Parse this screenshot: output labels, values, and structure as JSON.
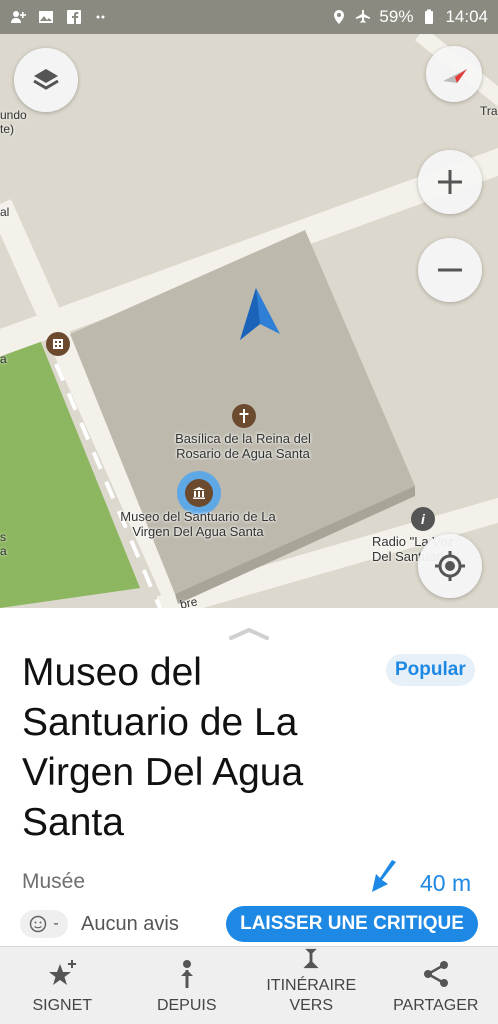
{
  "status_bar": {
    "battery": "59%",
    "time": "14:04",
    "icons": [
      "add-contact-icon",
      "image-icon",
      "facebook-icon",
      "more-dots-icon",
      "location-icon",
      "airplane-icon",
      "battery-icon"
    ]
  },
  "map": {
    "labels": {
      "basilica": "Basílica de la Reina del Rosario de Agua Santa",
      "museum": "Museo del Santuario de La Virgen Del Agua Santa",
      "radio": "Radio \"La Voz Del Santuario\"",
      "top_left": "undo\nte)",
      "left_mid": "al",
      "left_a": "a",
      "left_s": "s\na",
      "top_right": "Tra",
      "street": "bre"
    },
    "controls": {
      "layers": "layers-icon",
      "compass": "compass-icon",
      "zoom_in": "plus-icon",
      "zoom_out": "minus-icon",
      "my_location": "my-location-icon"
    }
  },
  "place": {
    "title": "Museo del Santuario de La Virgen Del Agua Santa",
    "badge": "Popular",
    "category": "Musée",
    "distance": "40 m",
    "rating": "-",
    "reviews": "Aucun avis",
    "review_button": "LAISSER UNE CRITIQUE"
  },
  "actions": [
    {
      "label": "SIGNET",
      "icon": "bookmark-star-icon"
    },
    {
      "label": "DEPUIS",
      "icon": "route-from-icon"
    },
    {
      "label": "ITINÉRAIRE\nVERS",
      "icon": "route-to-icon"
    },
    {
      "label": "PARTAGER",
      "icon": "share-icon"
    }
  ],
  "colors": {
    "accent": "#1e88e5",
    "map_background": "#dcd8cd",
    "building": "#bdb9ad",
    "park": "#8cb65f",
    "poi_brown": "#6b4a2e"
  }
}
